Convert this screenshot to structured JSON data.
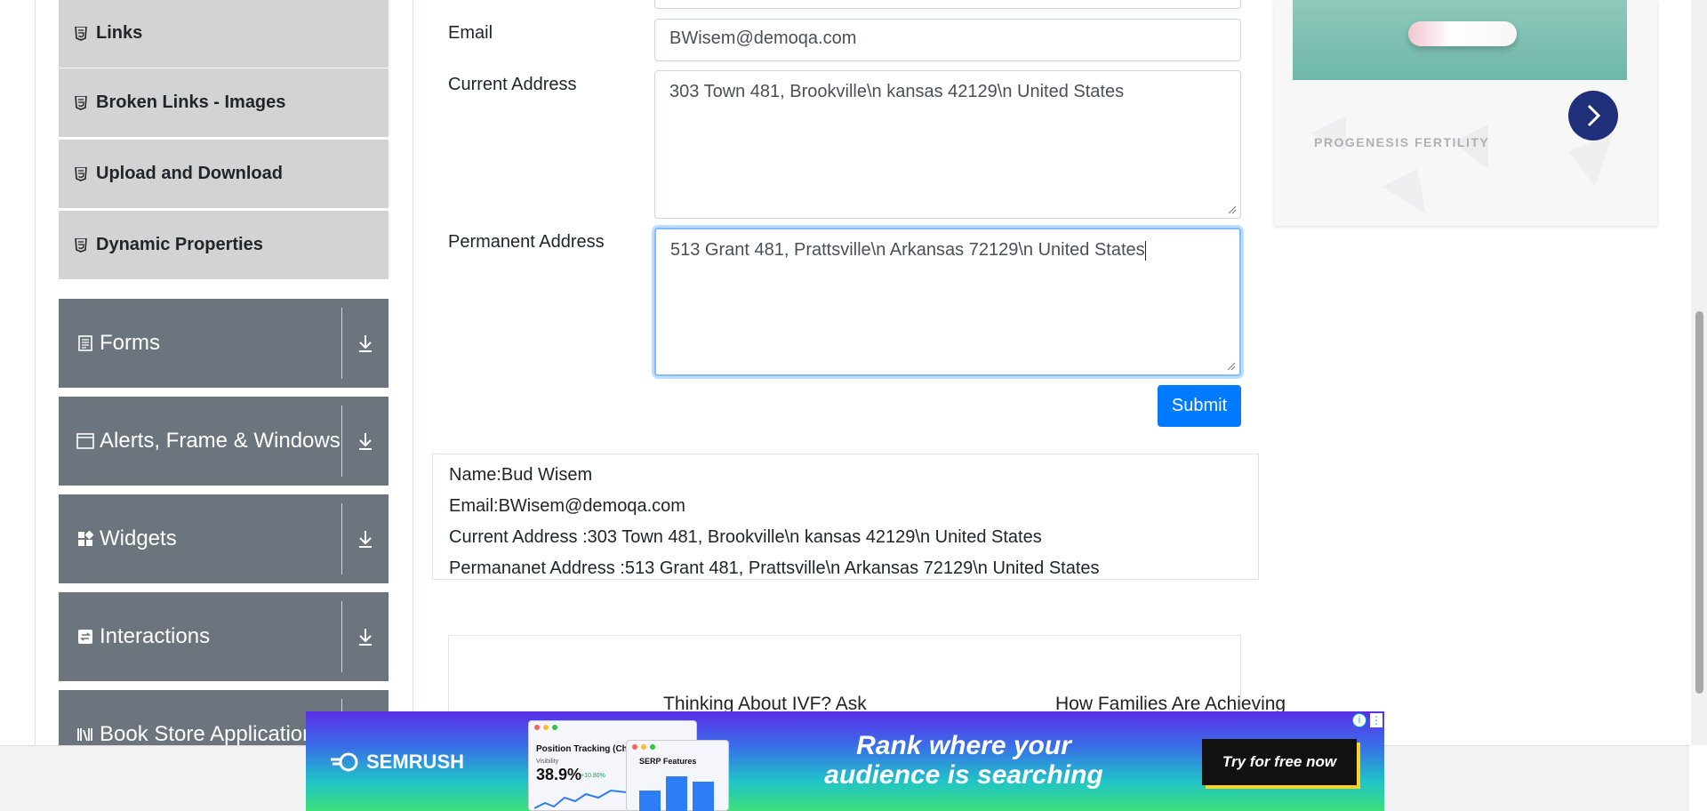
{
  "sidebar": {
    "menu_items": [
      {
        "label": "Links"
      },
      {
        "label": "Broken Links - Images"
      },
      {
        "label": "Upload and Download"
      },
      {
        "label": "Dynamic Properties"
      }
    ],
    "groups": [
      {
        "label": "Forms",
        "icon": "form-icon"
      },
      {
        "label": "Alerts, Frame & Windows",
        "icon": "window-icon"
      },
      {
        "label": "Widgets",
        "icon": "widgets-icon"
      },
      {
        "label": "Interactions",
        "icon": "interactions-icon"
      },
      {
        "label": "Book Store Application",
        "icon": "book-icon"
      }
    ]
  },
  "form": {
    "email_label": "Email",
    "email_value": "BWisem@demoqa.com",
    "current_address_label": "Current Address",
    "current_address_value": "303 Town 481, Brookville\\n kansas 42129\\n United States",
    "permanent_address_label": "Permanent Address",
    "permanent_address_value": "513 Grant 481, Prattsville\\n Arkansas 72129\\n United States",
    "submit_label": "Submit"
  },
  "output": {
    "name": "Name:Bud Wisem",
    "email": "Email:BWisem@demoqa.com",
    "current_address": "Current Address :303 Town 481, Brookville\\n kansas 42129\\n United States",
    "permanent_address": "Permananet Address :513 Grant 481, Prattsville\\n Arkansas 72129\\n United States"
  },
  "lower_ad": {
    "left_text": "Thinking About IVF? Ask",
    "right_text": "How Families Are Achieving"
  },
  "side_ad": {
    "brand": "PROGENESIS FERTILITY"
  },
  "banner": {
    "brand": "SEMRUSH",
    "headline_line1": "Rank where your",
    "headline_line2": "audience is searching",
    "cta": "Try for free now",
    "win1_title": "Position Tracking (ChatG",
    "win1_sub": "Visibility",
    "win1_value": "38.9%",
    "win1_delta": "+10.80%",
    "win2_title": "SERP Features"
  },
  "colors": {
    "primary": "#007bff",
    "group_bg": "#6c757d",
    "menu_bg": "#d3d3d3"
  }
}
